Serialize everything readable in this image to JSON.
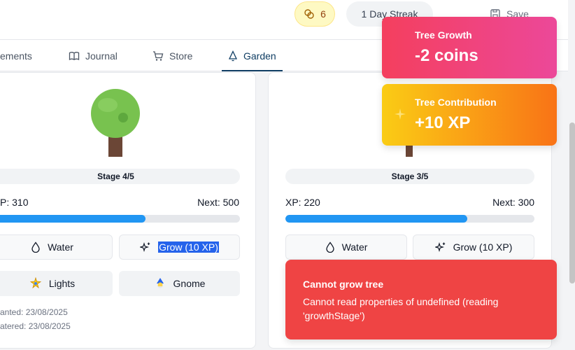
{
  "header": {
    "coins": "6",
    "streak": "1 Day Streak",
    "save_label": "Save"
  },
  "nav": {
    "tabs": [
      {
        "label": "ements",
        "icon": "partial-icon"
      },
      {
        "label": "Journal",
        "icon": "book-icon"
      },
      {
        "label": "Store",
        "icon": "cart-icon"
      },
      {
        "label": "Garden",
        "icon": "bell-tree-icon",
        "active": true
      }
    ]
  },
  "trees": [
    {
      "stage": "Stage 4/5",
      "xp_label": "P: 310",
      "next_label": "Next: 500",
      "progress": 0.62,
      "water_label": "Water",
      "grow_label": "Grow (10 XP)",
      "lights_label": "Lights",
      "gnome_label": "Gnome",
      "planted": "anted: 23/08/2025",
      "watered": "atered: 23/08/2025"
    },
    {
      "stage": "Stage 3/5",
      "xp_label": "XP: 220",
      "next_label": "Next: 300",
      "progress": 0.73,
      "water_label": "Water",
      "grow_label": "Grow (10 XP)"
    }
  ],
  "toasts": {
    "growth": {
      "title": "Tree Growth",
      "value": "-2 coins"
    },
    "contribution": {
      "title": "Tree Contribution",
      "value": "+10 XP"
    },
    "error": {
      "title": "Cannot grow tree",
      "message": "Cannot read properties of undefined (reading 'growthStage')"
    }
  },
  "colors": {
    "progress": "#2196f3",
    "active_tab": "#0f3d63",
    "error": "#ef4444"
  }
}
